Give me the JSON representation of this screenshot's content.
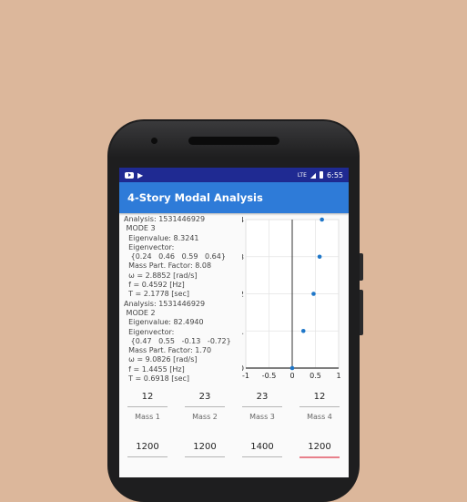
{
  "status_bar": {
    "time": "6:55",
    "network": "LTE"
  },
  "app": {
    "title": "4-Story Modal Analysis"
  },
  "results_lines": [
    "Analysis: 1531446929",
    " MODE 3",
    "  Eigenvalue: 8.3241",
    "  Eigenvector:",
    "   {0.24   0.46   0.59   0.64}",
    "  Mass Part. Factor: 8.08",
    "  ω = 2.8852 [rad/s]",
    "  f = 0.4592 [Hz]",
    "  T = 2.1778 [sec]",
    "Analysis: 1531446929",
    " MODE 2",
    "  Eigenvalue: 82.4940",
    "  Eigenvector:",
    "   {0.47   0.55   -0.13   -0.72}",
    "  Mass Part. Factor: 1.70",
    "  ω = 9.0826 [rad/s]",
    "  f = 1.4455 [Hz]",
    "  T = 0.6918 [sec]",
    "Analysis: 1531446929"
  ],
  "chart_data": {
    "type": "scatter",
    "x_ticks": [
      "-1",
      "-0.5",
      "0",
      "0.5",
      "1"
    ],
    "y_ticks": [
      "0",
      "1",
      "2",
      "3",
      "4"
    ],
    "xlim": [
      -1,
      1
    ],
    "ylim": [
      0,
      4
    ],
    "points": [
      {
        "x": 0,
        "y": 0
      },
      {
        "x": 0.24,
        "y": 1
      },
      {
        "x": 0.46,
        "y": 2
      },
      {
        "x": 0.59,
        "y": 3
      },
      {
        "x": 0.64,
        "y": 4
      }
    ],
    "grid": true,
    "point_color": "#1f77c9"
  },
  "masses": [
    {
      "value": "12",
      "label": "Mass 1"
    },
    {
      "value": "23",
      "label": "Mass 2"
    },
    {
      "value": "23",
      "label": "Mass 3"
    },
    {
      "value": "12",
      "label": "Mass 4"
    }
  ],
  "stiffnesses": [
    {
      "value": "1200"
    },
    {
      "value": "1200"
    },
    {
      "value": "1400"
    },
    {
      "value": "1200"
    }
  ]
}
